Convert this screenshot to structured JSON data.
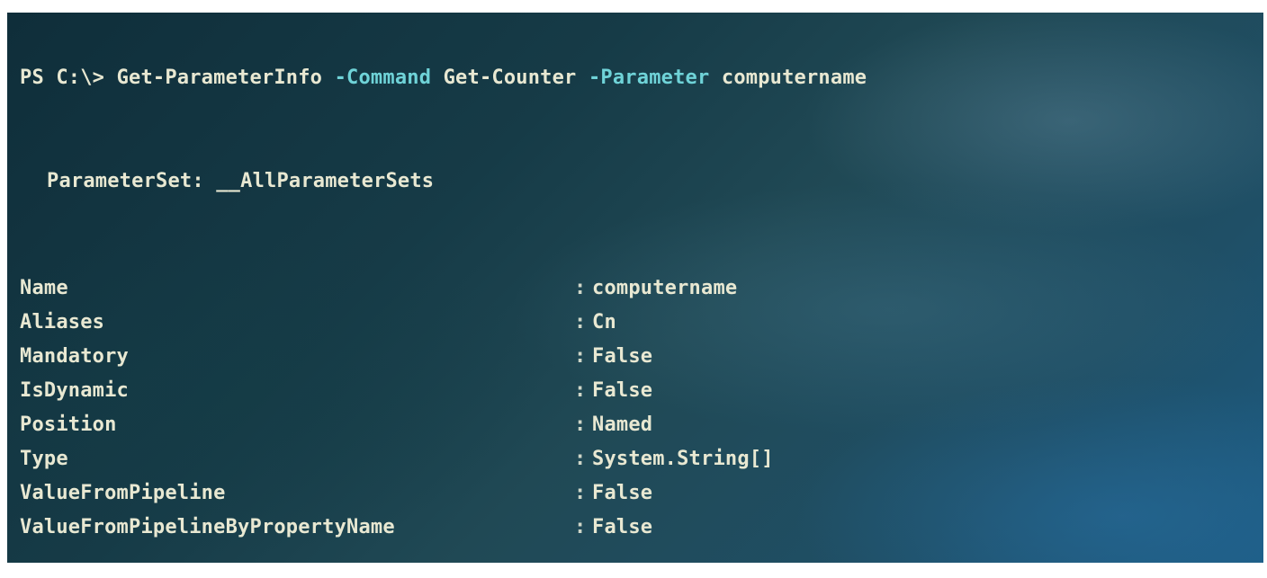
{
  "terminal": {
    "prompt": "PS C:\\> ",
    "command": "Get-ParameterInfo",
    "arg1_flag": "-Command",
    "arg1_value": "Get-Counter",
    "arg2_flag": "-Parameter",
    "arg2_value": "computername",
    "parameter_set_label": "ParameterSet: ",
    "parameter_set_value": "__AllParameterSets",
    "separator": ":",
    "properties": [
      {
        "key": "Name",
        "value": "computername"
      },
      {
        "key": "Aliases",
        "value": "Cn"
      },
      {
        "key": "Mandatory",
        "value": "False"
      },
      {
        "key": "IsDynamic",
        "value": "False"
      },
      {
        "key": "Position",
        "value": "Named"
      },
      {
        "key": "Type",
        "value": "System.String[]"
      },
      {
        "key": "ValueFromPipeline",
        "value": "False"
      },
      {
        "key": "ValueFromPipelineByPropertyName",
        "value": "False"
      }
    ]
  },
  "colors": {
    "text": "#e8e8d2",
    "parameter": "#6fd3d8",
    "background": "#1c4a58"
  }
}
